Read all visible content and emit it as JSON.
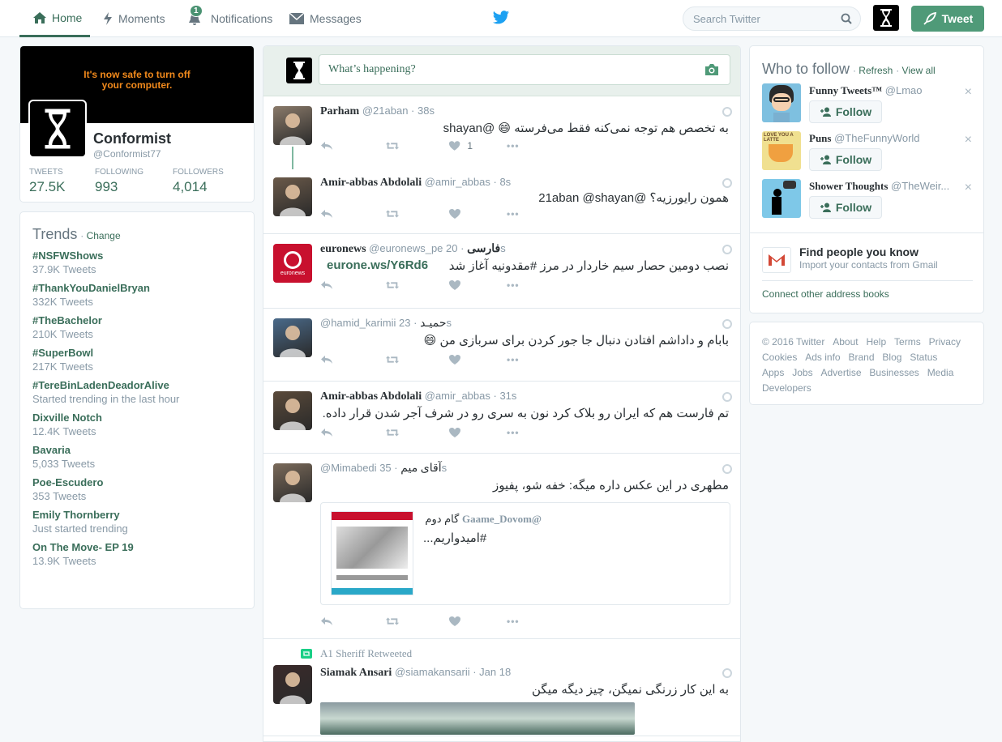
{
  "nav": {
    "home": "Home",
    "moments": "Moments",
    "notifications": "Notifications",
    "notif_badge": "1",
    "messages": "Messages"
  },
  "search": {
    "placeholder": "Search Twitter"
  },
  "tweet_button": "Tweet",
  "profile": {
    "banner_text": "It's now safe to turn off your computer.",
    "name": "Conformist",
    "handle": "@Conformist77",
    "stats": [
      {
        "label": "TWEETS",
        "value": "27.5K"
      },
      {
        "label": "FOLLOWING",
        "value": "993"
      },
      {
        "label": "FOLLOWERS",
        "value": "4,014"
      }
    ]
  },
  "trends": {
    "title": "Trends",
    "change": "Change",
    "items": [
      {
        "name": "#NSFWShows",
        "count": "37.9K Tweets"
      },
      {
        "name": "#ThankYouDanielBryan",
        "count": "332K Tweets"
      },
      {
        "name": "#TheBachelor",
        "count": "210K Tweets"
      },
      {
        "name": "#SuperBowl",
        "count": "217K Tweets"
      },
      {
        "name": "#TereBinLadenDeadorAlive",
        "count": "Started trending in the last hour"
      },
      {
        "name": "Dixville Notch",
        "count": "12.4K Tweets"
      },
      {
        "name": "Bavaria",
        "count": "5,033 Tweets"
      },
      {
        "name": "Poe-Escudero",
        "count": "353 Tweets"
      },
      {
        "name": "Emily Thornberry",
        "count": "Just started trending"
      },
      {
        "name": "On The Move- EP 19",
        "count": "13.9K Tweets"
      }
    ]
  },
  "compose": {
    "placeholder": "What’s happening?"
  },
  "tweets": [
    {
      "name": "Parham",
      "handle": "@21aban",
      "time": "· 38s",
      "text": "به تخصص هم توجه نمی‌کنه فقط می‌فرسته 😄 @shayan",
      "likes": "1"
    },
    {
      "name": "Amir-abbas Abdolali",
      "handle": "@amir_abbas",
      "time": "· 8s",
      "text": "همون رایورزیه؟ @21aban @shayan",
      "likes": ""
    },
    {
      "name": "euronews",
      "handle": "@euronews_pe",
      "name2": "فارسی",
      "time": "· 20s",
      "text": "نصب دومین حصار سیم خاردار در مرز #مقدونیه آغاز شد",
      "link": "eurone.ws/Y6Rd6",
      "likes": ""
    },
    {
      "name": "حمیـد",
      "handle": "@hamid_karimii",
      "time": "· 23s",
      "text": "بابام و داداشم افتادن دنبال جا جور کردن برای سربازی من 😄",
      "likes": ""
    },
    {
      "name": "Amir-abbas Abdolali",
      "handle": "@amir_abbas",
      "time": "· 31s",
      "text": "تم فارست هم که ایران رو بلاک کرد نون به سری رو در شرف آجر شدن قرار داده.",
      "likes": ""
    },
    {
      "name": "آقای میم",
      "handle": "@Mimabedi",
      "time": "· 35s",
      "text": "مطهری در این عکس داره میگه: خفه شو، پفیوز",
      "quote_name": "گام دوم",
      "quote_handle": "@Gaame_Dovom",
      "quote_text": "#امیدواریم...",
      "likes": ""
    },
    {
      "retweeted_by": "A1 Sheriff Retweeted",
      "name": "Siamak Ansari",
      "handle": "@siamakansarii",
      "time": "· Jan 18",
      "text": "به این کار زرنگی نمیگن، چیز دیگه میگن"
    }
  ],
  "who_to_follow": {
    "title": "Who to follow",
    "refresh": "Refresh",
    "view_all": "View all",
    "follow_label": "Follow",
    "items": [
      {
        "name": "Funny Tweets™",
        "handle": "@Lmao"
      },
      {
        "name": "Puns",
        "handle": "@TheFunnyWorld"
      },
      {
        "name": "Shower Thoughts",
        "handle": "@TheWeir..."
      }
    ],
    "find_title": "Find people you know",
    "find_sub": "Import your contacts from Gmail",
    "connect": "Connect other address books",
    "avatar_text": "LOVE YOU A LATTE"
  },
  "footer": [
    "© 2016 Twitter",
    "About",
    "Help",
    "Terms",
    "Privacy",
    "Cookies",
    "Ads info",
    "Brand",
    "Blog",
    "Status",
    "Apps",
    "Jobs",
    "Advertise",
    "Businesses",
    "Media",
    "Developers"
  ],
  "colors": {
    "accent": "#3a6e5a",
    "button": "#4f9a78",
    "twitter_bird": "#1da1f2"
  }
}
